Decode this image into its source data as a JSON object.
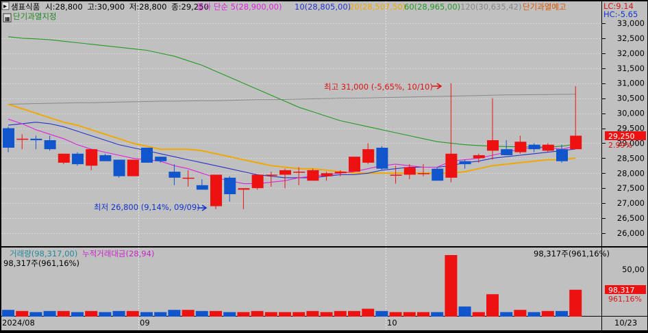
{
  "stock": {
    "name": "샘표식품",
    "open_label": "시:28,800",
    "high_label": "고:30,900",
    "low_label": "저:28,800",
    "close_label": "종:29,250"
  },
  "legend": [
    {
      "text": "종가 단순 5(28,900,00)",
      "color": "#dd22dd"
    },
    {
      "text": "10(28,805,00)",
      "color": "#2233cc"
    },
    {
      "text": "20(28,507,50)",
      "color": "#f0a800"
    },
    {
      "text": "60(28,965,00)",
      "color": "#229922"
    },
    {
      "text": "120(30,635,42)",
      "color": "#888888"
    },
    {
      "text": "단기과열예고",
      "color": "#dd5500"
    }
  ],
  "sublabel": "단기과열지정",
  "right_info": {
    "lc": "LC:9.14",
    "hc": "HC:-5.65"
  },
  "annotations": {
    "high": "최고 31,000 (-5,65%, 10/10)",
    "low": "최저 26,800 (9,14%, 09/09)"
  },
  "price_badge": {
    "value": "29,250",
    "pct": "2.99%"
  },
  "volume_panel": {
    "label": "거래량(98,317,00)",
    "cum_label": "누적거래대금(28,94)",
    "left_value": "98,317주(961,16%)",
    "right_value": "98,317주(961,16%)",
    "badge_value": "98,317",
    "badge_pct": "961,16%"
  },
  "x_labels": {
    "start": "2024/08",
    "sep": "09",
    "oct": "10",
    "end": "10/23"
  },
  "colors": {
    "up": "#ee1111",
    "down": "#1155cc",
    "bg": "#c0c0c0"
  },
  "chart_data": {
    "type": "candlestick",
    "price_axis": {
      "min": 25600,
      "max": 33400,
      "ticks": [
        26000,
        26500,
        27000,
        27500,
        28000,
        28500,
        29000,
        29500,
        30000,
        30500,
        31000,
        31500,
        32000,
        32500,
        33000
      ]
    },
    "volume_axis": {
      "ticks": [
        50,
        100
      ]
    },
    "candles": [
      {
        "o": 29500,
        "h": 29550,
        "l": 28700,
        "c": 28850,
        "v": 6
      },
      {
        "o": 29150,
        "h": 29300,
        "l": 28800,
        "c": 29150,
        "v": 5
      },
      {
        "o": 29150,
        "h": 29250,
        "l": 28800,
        "c": 29100,
        "v": 4
      },
      {
        "o": 29100,
        "h": 29250,
        "l": 28750,
        "c": 28800,
        "v": 5
      },
      {
        "o": 28350,
        "h": 28650,
        "l": 28300,
        "c": 28650,
        "v": 5
      },
      {
        "o": 28650,
        "h": 28700,
        "l": 28250,
        "c": 28300,
        "v": 4
      },
      {
        "o": 28250,
        "h": 28800,
        "l": 28100,
        "c": 28800,
        "v": 5
      },
      {
        "o": 28600,
        "h": 28650,
        "l": 28400,
        "c": 28400,
        "v": 4
      },
      {
        "o": 28450,
        "h": 28450,
        "l": 27850,
        "c": 27900,
        "v": 5
      },
      {
        "o": 27900,
        "h": 28450,
        "l": 27900,
        "c": 28450,
        "v": 5
      },
      {
        "o": 28850,
        "h": 28850,
        "l": 28350,
        "c": 28350,
        "v": 4
      },
      {
        "o": 28550,
        "h": 28550,
        "l": 28350,
        "c": 28400,
        "v": 4
      },
      {
        "o": 28050,
        "h": 28300,
        "l": 27600,
        "c": 27850,
        "v": 6
      },
      {
        "o": 27850,
        "h": 28100,
        "l": 27550,
        "c": 27850,
        "v": 6
      },
      {
        "o": 27600,
        "h": 27800,
        "l": 27450,
        "c": 27450,
        "v": 5
      },
      {
        "o": 26900,
        "h": 27900,
        "l": 26800,
        "c": 27950,
        "v": 5
      },
      {
        "o": 27850,
        "h": 27900,
        "l": 27050,
        "c": 27300,
        "v": 4
      },
      {
        "o": 27450,
        "h": 27450,
        "l": 26800,
        "c": 27500,
        "v": 4
      },
      {
        "o": 27500,
        "h": 27950,
        "l": 27450,
        "c": 27950,
        "v": 5
      },
      {
        "o": 27950,
        "h": 28050,
        "l": 27550,
        "c": 27950,
        "v": 4
      },
      {
        "o": 27950,
        "h": 28150,
        "l": 27500,
        "c": 28100,
        "v": 4
      },
      {
        "o": 28050,
        "h": 28200,
        "l": 27600,
        "c": 28050,
        "v": 4
      },
      {
        "o": 27750,
        "h": 28150,
        "l": 27750,
        "c": 28100,
        "v": 5
      },
      {
        "o": 27900,
        "h": 28050,
        "l": 27750,
        "c": 28000,
        "v": 4
      },
      {
        "o": 28000,
        "h": 28100,
        "l": 27900,
        "c": 28050,
        "v": 5
      },
      {
        "o": 28050,
        "h": 28550,
        "l": 28050,
        "c": 28550,
        "v": 5
      },
      {
        "o": 28350,
        "h": 29000,
        "l": 28300,
        "c": 28800,
        "v": 7
      },
      {
        "o": 28850,
        "h": 28900,
        "l": 28100,
        "c": 28150,
        "v": 5
      },
      {
        "o": 27950,
        "h": 28250,
        "l": 27650,
        "c": 27950,
        "v": 4
      },
      {
        "o": 27950,
        "h": 28300,
        "l": 27800,
        "c": 28200,
        "v": 4
      },
      {
        "o": 28000,
        "h": 28300,
        "l": 27900,
        "c": 28000,
        "v": 4
      },
      {
        "o": 28150,
        "h": 28200,
        "l": 27750,
        "c": 27750,
        "v": 4
      },
      {
        "o": 27850,
        "h": 31000,
        "l": 27700,
        "c": 28650,
        "v": 55
      },
      {
        "o": 28400,
        "h": 28450,
        "l": 28150,
        "c": 28300,
        "v": 9
      },
      {
        "o": 28500,
        "h": 28650,
        "l": 28350,
        "c": 28600,
        "v": 4
      },
      {
        "o": 28750,
        "h": 30500,
        "l": 28450,
        "c": 29100,
        "v": 20
      },
      {
        "o": 28800,
        "h": 29100,
        "l": 28650,
        "c": 28600,
        "v": 4
      },
      {
        "o": 28700,
        "h": 29250,
        "l": 28650,
        "c": 29050,
        "v": 6
      },
      {
        "o": 28950,
        "h": 29000,
        "l": 28700,
        "c": 28800,
        "v": 4
      },
      {
        "o": 28750,
        "h": 29000,
        "l": 28700,
        "c": 28950,
        "v": 5
      },
      {
        "o": 28800,
        "h": 28950,
        "l": 28350,
        "c": 28400,
        "v": 5
      },
      {
        "o": 28800,
        "h": 30900,
        "l": 28800,
        "c": 29250,
        "v": 24
      }
    ],
    "ma5_series": [
      29800,
      29650,
      29450,
      29300,
      29150,
      28950,
      28800,
      28700,
      28600,
      28500,
      28450,
      28400,
      28250,
      28150,
      28000,
      27850,
      27750,
      27650,
      27650,
      27700,
      27750,
      27850,
      27900,
      27950,
      28000,
      28050,
      28150,
      28250,
      28300,
      28250,
      28200,
      28200,
      28400,
      28450,
      28500,
      28600,
      28700,
      28800,
      28850,
      28850,
      28800,
      28900
    ],
    "ma10_series": [
      29600,
      29650,
      29700,
      29650,
      29550,
      29400,
      29250,
      29100,
      28950,
      28850,
      28750,
      28650,
      28550,
      28450,
      28350,
      28250,
      28150,
      28050,
      27950,
      27900,
      27850,
      27850,
      27850,
      27900,
      27950,
      27950,
      28000,
      28100,
      28150,
      28200,
      28200,
      28200,
      28250,
      28350,
      28400,
      28500,
      28550,
      28600,
      28650,
      28700,
      28750,
      28805
    ],
    "ma20_series": [
      30300,
      30150,
      30000,
      29850,
      29700,
      29600,
      29450,
      29300,
      29150,
      29000,
      28900,
      28800,
      28800,
      28800,
      28750,
      28650,
      28550,
      28450,
      28350,
      28250,
      28200,
      28150,
      28150,
      28100,
      28050,
      28000,
      28000,
      28000,
      28000,
      28000,
      28000,
      28000,
      28000,
      28050,
      28150,
      28250,
      28300,
      28350,
      28400,
      28450,
      28450,
      28507
    ],
    "ma60_series": [
      32550,
      32500,
      32480,
      32450,
      32400,
      32350,
      32300,
      32250,
      32200,
      32150,
      32100,
      32000,
      31900,
      31750,
      31600,
      31400,
      31200,
      31000,
      30800,
      30600,
      30400,
      30200,
      30050,
      29900,
      29750,
      29650,
      29550,
      29450,
      29350,
      29250,
      29150,
      29050,
      29000,
      28950,
      28920,
      28900,
      28890,
      28880,
      28870,
      28870,
      28900,
      28965
    ],
    "ma120_series": [
      30300,
      30310,
      30320,
      30330,
      30340,
      30350,
      30350,
      30360,
      30370,
      30380,
      30390,
      30400,
      30400,
      30410,
      30420,
      30420,
      30430,
      30440,
      30450,
      30450,
      30460,
      30470,
      30480,
      30490,
      30500,
      30500,
      30510,
      30520,
      30530,
      30540,
      30550,
      30560,
      30570,
      30580,
      30590,
      30600,
      30610,
      30615,
      30620,
      30625,
      30630,
      30635
    ]
  }
}
